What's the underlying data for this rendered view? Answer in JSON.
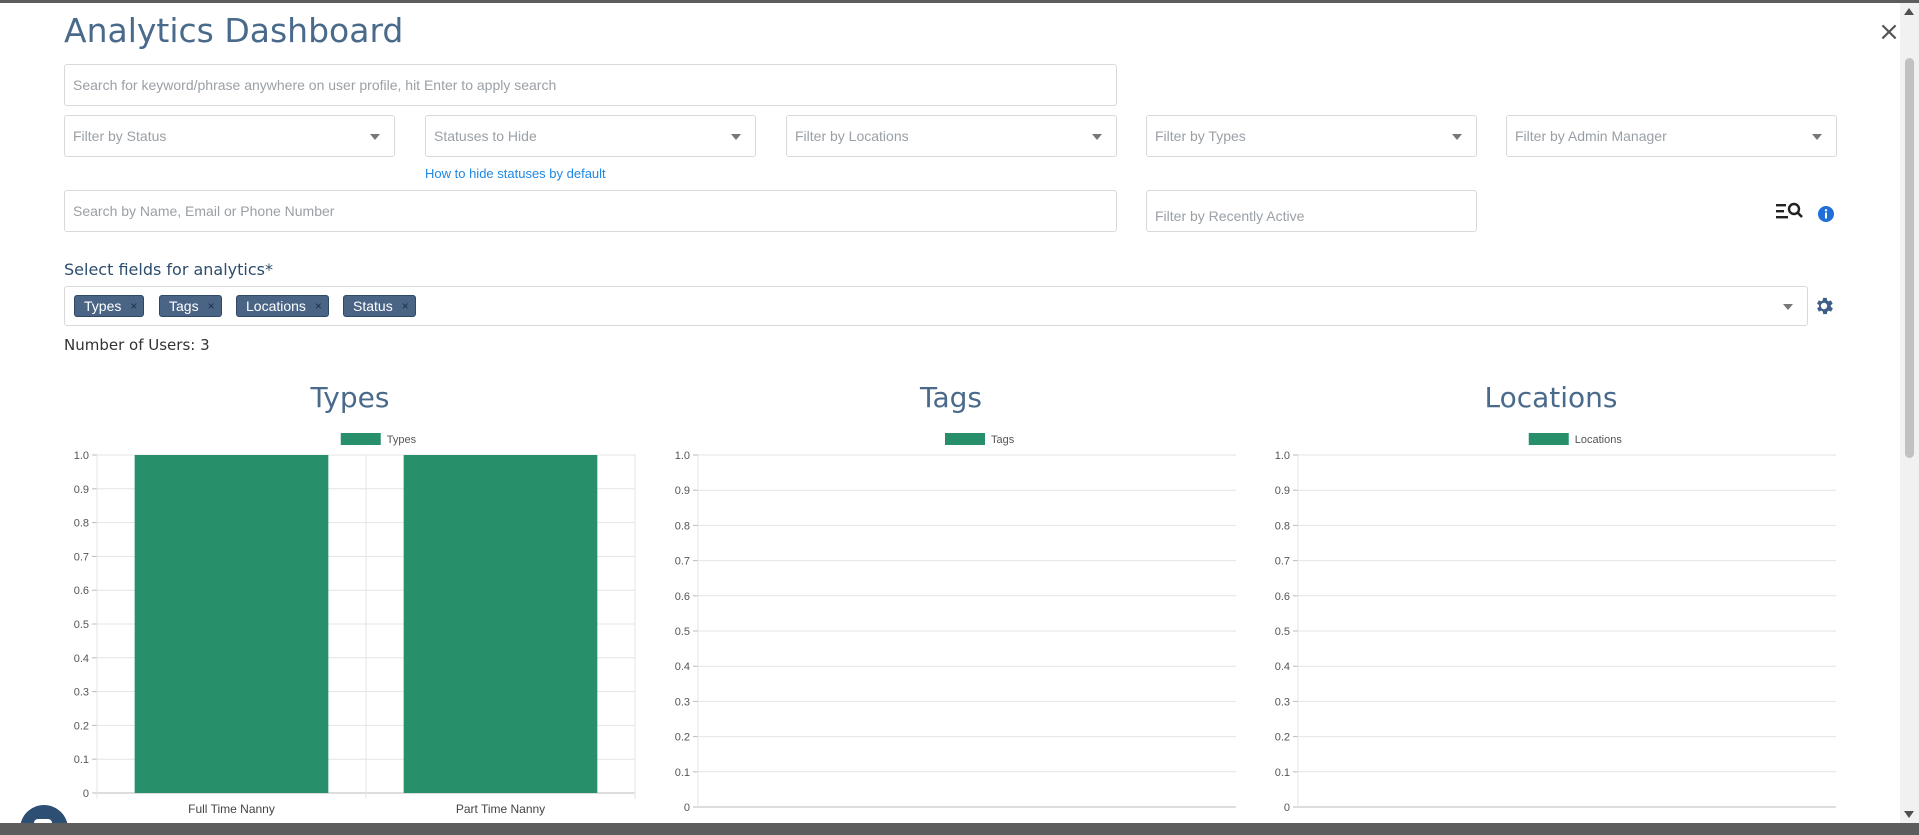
{
  "header": {
    "title": "Analytics Dashboard",
    "close_icon": "close-icon"
  },
  "filters": {
    "keyword_search_placeholder": "Search for keyword/phrase anywhere on user profile, hit Enter to apply search",
    "status_placeholder": "Filter by Status",
    "statuses_hide_placeholder": "Statuses to Hide",
    "locations_placeholder": "Filter by Locations",
    "types_placeholder": "Filter by Types",
    "admin_manager_placeholder": "Filter by Admin Manager",
    "hide_statuses_link": "How to hide statuses by default",
    "name_search_placeholder": "Search by Name, Email or Phone Number",
    "recently_active_placeholder": "Filter by Recently Active",
    "advanced_search_icon": "list-search-icon",
    "info_icon": "info-icon"
  },
  "analytics": {
    "label": "Select fields for analytics*",
    "chips": [
      {
        "label": "Types"
      },
      {
        "label": "Tags"
      },
      {
        "label": "Locations"
      },
      {
        "label": "Status"
      }
    ],
    "settings_icon": "gear-icon",
    "user_count": "Number of Users: 3"
  },
  "colors": {
    "accent": "#4a6a8c",
    "bar": "#27906b",
    "chip": "#4a6486",
    "link": "#1e88e5"
  },
  "chart_data": [
    {
      "type": "bar",
      "title": "Types",
      "legend": [
        "Types"
      ],
      "categories": [
        "Full Time Nanny",
        "Part Time Nanny"
      ],
      "values": [
        1,
        1
      ],
      "ylim": [
        0,
        1
      ],
      "yticks": [
        "0",
        "0.1",
        "0.2",
        "0.3",
        "0.4",
        "0.5",
        "0.6",
        "0.7",
        "0.8",
        "0.9",
        "1.0"
      ],
      "grid": true,
      "legend_position": "top"
    },
    {
      "type": "bar",
      "title": "Tags",
      "legend": [
        "Tags"
      ],
      "categories": [],
      "values": [],
      "ylim": [
        0,
        1
      ],
      "yticks": [
        "0",
        "0.1",
        "0.2",
        "0.3",
        "0.4",
        "0.5",
        "0.6",
        "0.7",
        "0.8",
        "0.9",
        "1.0"
      ],
      "grid": true,
      "legend_position": "top"
    },
    {
      "type": "bar",
      "title": "Locations",
      "legend": [
        "Locations"
      ],
      "categories": [],
      "values": [],
      "ylim": [
        0,
        1
      ],
      "yticks": [
        "0",
        "0.1",
        "0.2",
        "0.3",
        "0.4",
        "0.5",
        "0.6",
        "0.7",
        "0.8",
        "0.9",
        "1.0"
      ],
      "grid": true,
      "legend_position": "top"
    }
  ]
}
